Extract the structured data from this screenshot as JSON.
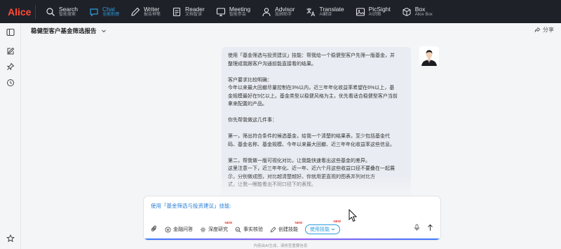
{
  "app": {
    "logo": "Alice"
  },
  "nav": [
    {
      "title": "Search",
      "sub": "智能搜索",
      "icon": "search-icon",
      "active": false
    },
    {
      "title": "Chat",
      "sub": "全能助理",
      "icon": "chat-icon",
      "active": true
    },
    {
      "title": "Writer",
      "sub": "报告神笔",
      "icon": "writer-icon",
      "active": false
    },
    {
      "title": "Reader",
      "sub": "文档智读",
      "icon": "reader-icon",
      "active": false
    },
    {
      "title": "Meeting",
      "sub": "智能参会",
      "icon": "meeting-icon",
      "active": false
    },
    {
      "title": "Advisor",
      "sub": "投顾助手",
      "icon": "advisor-icon",
      "active": false
    },
    {
      "title": "Translate",
      "sub": "AI翻译",
      "icon": "translate-icon",
      "active": false
    },
    {
      "title": "PicSight",
      "sub": "AI识图",
      "icon": "picsight-icon",
      "active": false
    },
    {
      "title": "Box",
      "sub": "Alice Box",
      "icon": "box-icon",
      "active": false
    }
  ],
  "header": {
    "title": "稳健型客户基金筛选报告",
    "share": "分享"
  },
  "message": {
    "lines": [
      "使用「基金筛选与投资建议」技能：帮我给一个稳健型客户先筛一版基金，并",
      "整理成我跟客户沟通前能直接看的结果。",
      "",
      "客户要求比较明确：",
      "今年以来最大回撤尽量控制在3%以内，近三年年化收益率希望在6%以上，基",
      "金规模最好在5亿以上。基金类型以稳健风格为主，优先看适合稳健型客户当前",
      "拿来配置的产品。",
      "",
      "你先帮我做这几件事：",
      "",
      "第一，筛出符合条件的候选基金，给我一个清楚的结果表，至少包括基金代",
      "码、基金名称、基金规模、今年以来最大回撤、近三年年化收益率这些信息。",
      "",
      "第二，帮我做一版可视化对比，让我能快速看出这些基金的差异。",
      "这里注意一下，近三年年化、近一年、近六个月这些收益口径不要叠在一起展",
      "示，分别做成图，对比越清楚越好。你就用更直观的图表并列对比方",
      "式，让我一眼能看出不同口径下的表现。"
    ]
  },
  "composer": {
    "prompt": "使用「基金筛选与投资建议」技能:",
    "tools": [
      {
        "label": "金融问答",
        "icon": "finance-qa-icon",
        "new": false
      },
      {
        "label": "深度研究",
        "icon": "deep-research-icon",
        "new": true
      },
      {
        "label": "事实核验",
        "icon": "fact-check-icon",
        "new": false
      },
      {
        "label": "创建技能",
        "icon": "create-skill-icon",
        "new": true
      }
    ],
    "skill_button": "使用技能",
    "skill_new": true,
    "new_label": "NEW"
  },
  "footer": "内容由AI生成，请核查重要信息"
}
